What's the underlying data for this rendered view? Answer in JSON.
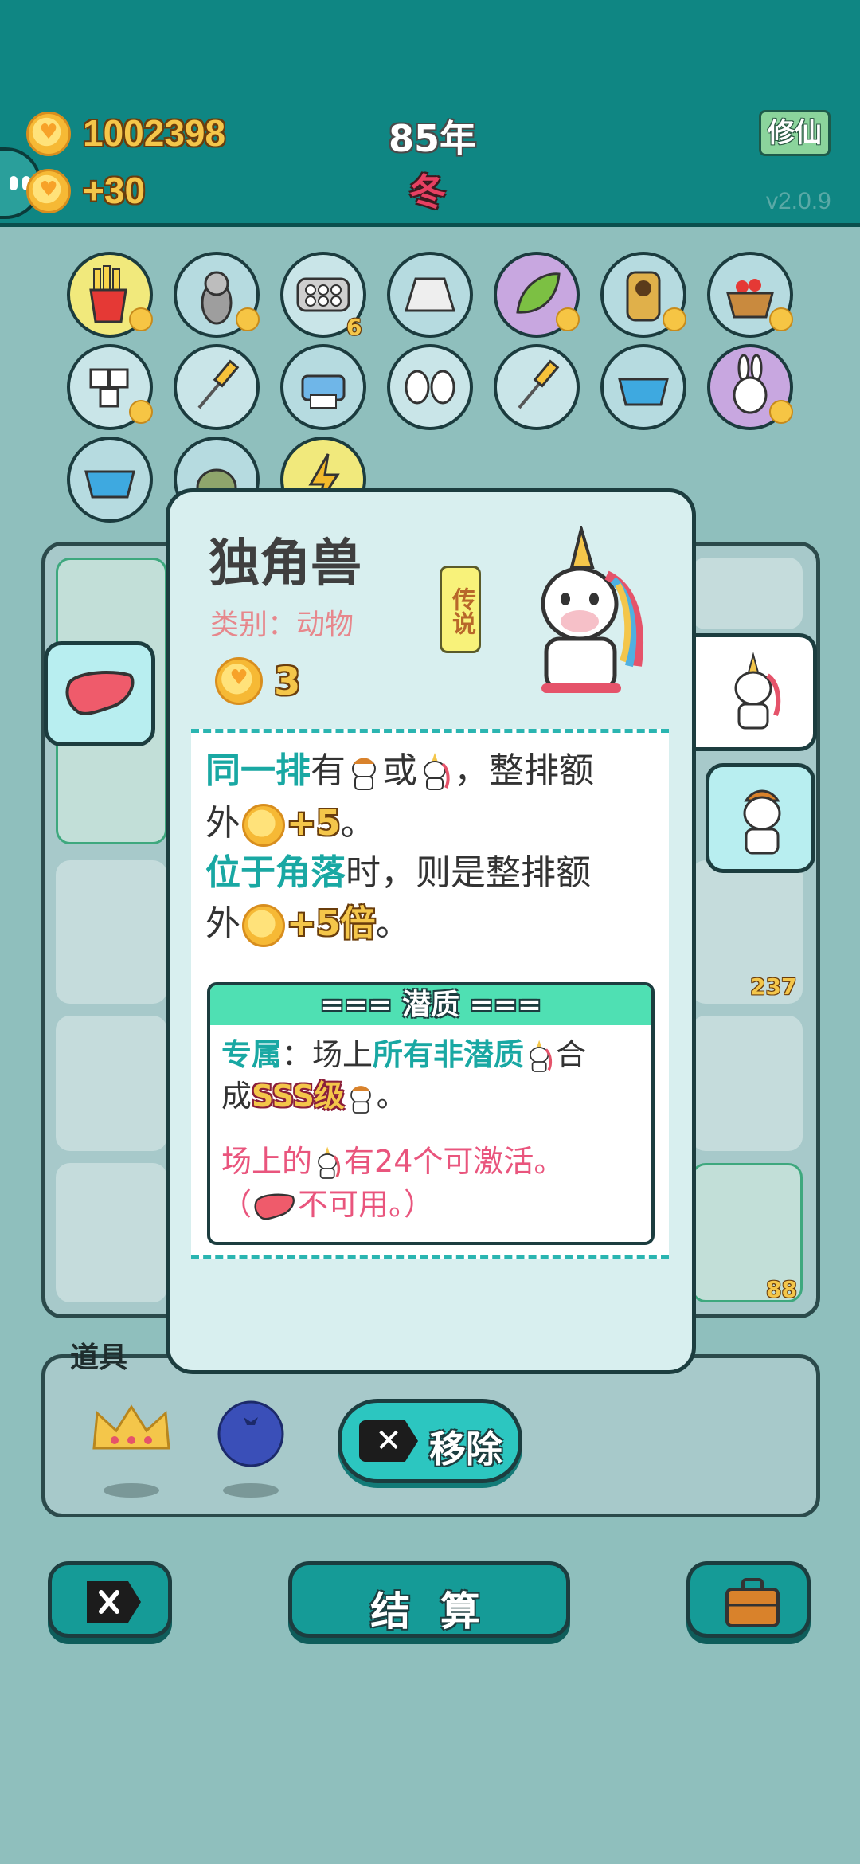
{
  "header": {
    "coins": "1002398",
    "income": "+30",
    "year": "85年",
    "season": "冬",
    "xiuxian_label": "修仙",
    "version": "v2.0.9"
  },
  "grid_counts": {
    "plate": "6"
  },
  "board_counts": {
    "farmer": "237",
    "cowboy": "88"
  },
  "card": {
    "name": "独角兽",
    "category": "类别：动物",
    "rarity": "传说",
    "cost": "3",
    "desc": {
      "l1_a": "同一排",
      "l1_b": "有",
      "l1_c": "或",
      "l1_d": "，整排额",
      "l2_a": "外",
      "l2_b": "+5",
      "l2_c": "。",
      "l3_a": "位于角落",
      "l3_b": "时，则是整排额",
      "l4_a": "外",
      "l4_b": "+5倍",
      "l4_c": "。"
    },
    "trait": {
      "header": "=== 潜质 ===",
      "line1_a": "专属",
      "line1_b": "：场上",
      "line1_c": "所有非潜质",
      "line1_d": "合",
      "line2_a": "成",
      "line2_b": "SSS级",
      "line2_c": "。",
      "line3_a": "场上的",
      "line3_b": "有24个可激活。",
      "line4_a": "（",
      "line4_b": "不可用。）"
    }
  },
  "tools": {
    "label": "道具",
    "remove_label": "移除"
  },
  "bottom": {
    "settle_label": "结 算"
  },
  "colors": {
    "header_bg": "#0f8683",
    "accent_teal": "#19a8a3",
    "coin_gold": "#f4c64a",
    "pink_text": "#e9557d"
  }
}
